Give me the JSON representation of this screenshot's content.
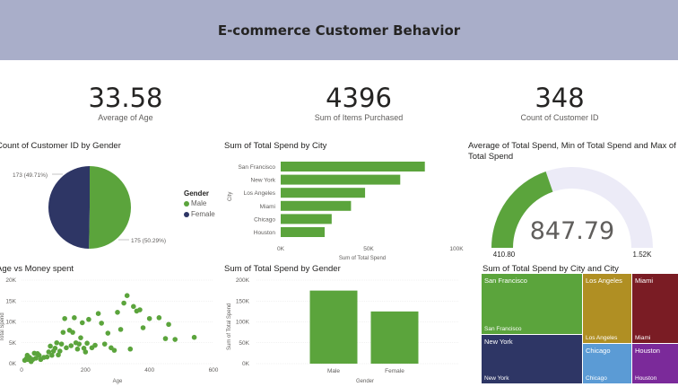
{
  "header": {
    "title": "E-commerce Customer Behavior",
    "bg": "#a9aec9"
  },
  "kpis": [
    {
      "value": "33.58",
      "label": "Average of Age"
    },
    {
      "value": "4396",
      "label": "Sum of Items Purchased"
    },
    {
      "value": "348",
      "label": "Count of Customer ID"
    }
  ],
  "colors": {
    "green": "#5ba43c",
    "navy": "#2e3665",
    "gold": "#b08f23",
    "maroon": "#7a1c24",
    "blue": "#5b9bd5",
    "purple": "#7b2a9a",
    "gauge_bg": "#ecebf7"
  },
  "titles": {
    "pie": "Count of Customer ID by Gender",
    "city_bar": "Sum of Total Spend by City",
    "gauge": "Average of Total Spend, Min of Total Spend and Max of Total Spend",
    "scatter": "Age vs Money spent",
    "gender_bar": "Sum of Total Spend by Gender",
    "treemap": "Sum of Total Spend by City and City"
  },
  "pie_labels": {
    "female": "173 (49.71%)",
    "male": "175 (50.29%)"
  },
  "legend": {
    "title": "Gender",
    "male": "Male",
    "female": "Female"
  },
  "city_axis": {
    "y_label": "City",
    "x_label": "Sum of Total Spend",
    "ticks": [
      "0K",
      "50K",
      "100K"
    ]
  },
  "gauge": {
    "value": "847.79",
    "min": "410.80",
    "max": "1.52K"
  },
  "scatter_axis": {
    "x_label": "Age",
    "y_label": "Total Spend",
    "x_ticks": [
      "0",
      "200",
      "400",
      "600"
    ],
    "y_ticks": [
      "20K",
      "15K",
      "10K",
      "5K",
      "0K"
    ]
  },
  "gender_axis": {
    "x_label": "Gender",
    "y_label": "Sum of Total Spend",
    "y_ticks": [
      "200K",
      "150K",
      "100K",
      "50K",
      "0K"
    ]
  },
  "treemap": [
    {
      "top": "San Francisco",
      "bottom": "San Francisco"
    },
    {
      "top": "Los Angeles",
      "bottom": "Los Angeles"
    },
    {
      "top": "Miami",
      "bottom": "Miami"
    },
    {
      "top": "New York",
      "bottom": "New York"
    },
    {
      "top": "Chicago",
      "bottom": "Chicago"
    },
    {
      "top": "Houston",
      "bottom": "Houston"
    }
  ],
  "chart_data": [
    {
      "type": "pie",
      "title": "Count of Customer ID by Gender",
      "categories": [
        "Male",
        "Female"
      ],
      "values": [
        175,
        173
      ],
      "legend": "right"
    },
    {
      "type": "bar",
      "orientation": "horizontal",
      "title": "Sum of Total Spend by City",
      "categories": [
        "San Francisco",
        "New York",
        "Los Angeles",
        "Miami",
        "Chicago",
        "Houston"
      ],
      "values": [
        82000,
        68000,
        48000,
        40000,
        29000,
        25000
      ],
      "xlim": [
        0,
        100000
      ],
      "xlabel": "Sum of Total Spend",
      "ylabel": "City"
    },
    {
      "type": "gauge",
      "title": "Average of Total Spend, Min of Total Spend and Max of Total Spend",
      "value": 847.79,
      "min": 410.8,
      "max": 1520
    },
    {
      "type": "scatter",
      "title": "Age vs Money spent",
      "xlabel": "Age",
      "ylabel": "Total Spend",
      "xlim": [
        0,
        600
      ],
      "ylim": [
        0,
        20000
      ],
      "points": [
        [
          10,
          800
        ],
        [
          15,
          1200
        ],
        [
          18,
          2000
        ],
        [
          20,
          1000
        ],
        [
          25,
          1500
        ],
        [
          30,
          500
        ],
        [
          35,
          1000
        ],
        [
          40,
          2500
        ],
        [
          45,
          1300
        ],
        [
          50,
          2400
        ],
        [
          55,
          2000
        ],
        [
          60,
          1000
        ],
        [
          70,
          1500
        ],
        [
          80,
          1600
        ],
        [
          85,
          2800
        ],
        [
          90,
          4200
        ],
        [
          95,
          2000
        ],
        [
          100,
          3000
        ],
        [
          105,
          3700
        ],
        [
          110,
          5000
        ],
        [
          115,
          2100
        ],
        [
          120,
          3000
        ],
        [
          125,
          4700
        ],
        [
          130,
          7500
        ],
        [
          135,
          10800
        ],
        [
          140,
          3800
        ],
        [
          150,
          8000
        ],
        [
          155,
          4300
        ],
        [
          160,
          7500
        ],
        [
          165,
          11000
        ],
        [
          170,
          5000
        ],
        [
          175,
          3500
        ],
        [
          180,
          4700
        ],
        [
          185,
          6200
        ],
        [
          190,
          9800
        ],
        [
          195,
          3700
        ],
        [
          200,
          2800
        ],
        [
          205,
          4900
        ],
        [
          210,
          10600
        ],
        [
          220,
          3800
        ],
        [
          230,
          4400
        ],
        [
          240,
          12000
        ],
        [
          250,
          9700
        ],
        [
          260,
          4700
        ],
        [
          270,
          7300
        ],
        [
          280,
          3800
        ],
        [
          290,
          3200
        ],
        [
          300,
          12300
        ],
        [
          310,
          8200
        ],
        [
          320,
          14500
        ],
        [
          330,
          16300
        ],
        [
          340,
          3500
        ],
        [
          350,
          13700
        ],
        [
          360,
          12600
        ],
        [
          370,
          12900
        ],
        [
          380,
          8600
        ],
        [
          400,
          10800
        ],
        [
          430,
          11000
        ],
        [
          450,
          6000
        ],
        [
          460,
          9400
        ],
        [
          480,
          5800
        ],
        [
          540,
          6300
        ]
      ]
    },
    {
      "type": "bar",
      "title": "Sum of Total Spend by Gender",
      "categories": [
        "Male",
        "Female"
      ],
      "values": [
        175000,
        125000
      ],
      "ylim": [
        0,
        200000
      ],
      "xlabel": "Gender",
      "ylabel": "Sum of Total Spend"
    },
    {
      "type": "treemap",
      "title": "Sum of Total Spend by City and City",
      "categories": [
        "San Francisco",
        "Los Angeles",
        "Miami",
        "New York",
        "Chicago",
        "Houston"
      ],
      "values": [
        82000,
        48000,
        40000,
        68000,
        29000,
        25000
      ]
    }
  ]
}
